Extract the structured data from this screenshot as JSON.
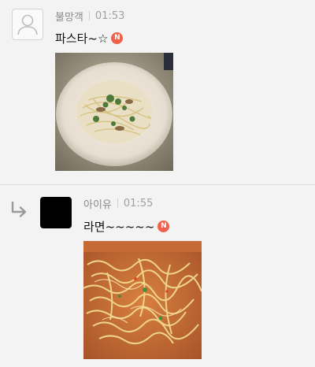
{
  "comments": [
    {
      "author": "불망객",
      "time": "01:53",
      "text": "파스타~☆",
      "badge": "N",
      "avatar": "default-user-icon",
      "image": "pasta-photo",
      "is_reply": false
    },
    {
      "author": "아이유",
      "time": "01:55",
      "text": "라면~~~~~",
      "badge": "N",
      "avatar": "black-square",
      "image": "ramen-photo",
      "is_reply": true
    }
  ],
  "colors": {
    "background": "#f3f3f3",
    "badge": "#f0604a",
    "meta_text": "#8a8a8a",
    "divider": "#dcdcdc"
  }
}
